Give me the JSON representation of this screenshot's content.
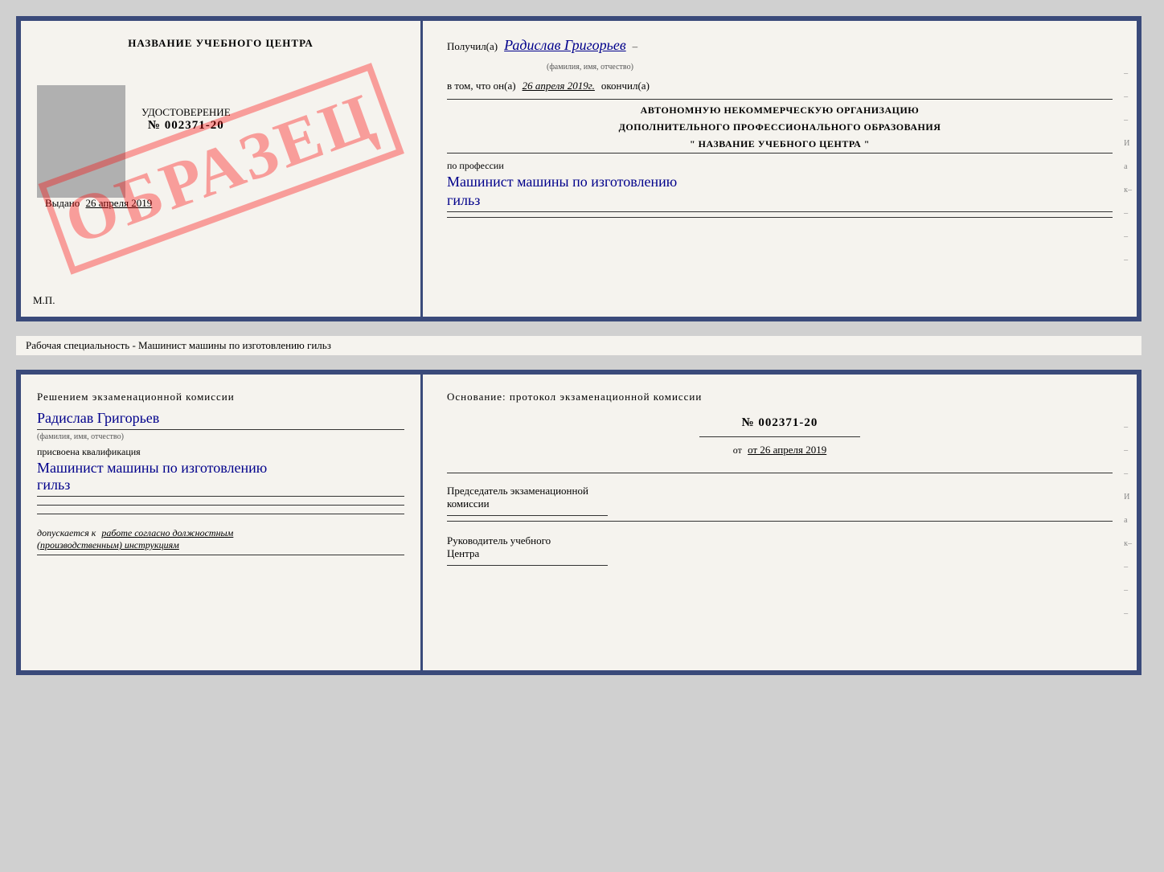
{
  "topCert": {
    "leftTitle": "НАЗВАНИЕ УЧЕБНОГО ЦЕНТРА",
    "photoAlt": "photo",
    "udostoverenie": "УДОСТОВЕРЕНИЕ",
    "number": "№ 002371-20",
    "vydano": "Выдано",
    "vydanoDate": "26 апреля 2019",
    "mp": "М.П.",
    "obrazec": "ОБРАЗЕЦ",
    "poluchil": "Получил(а)",
    "recipientName": "Радислав Григорьев",
    "fioLabel": "(фамилия, имя, отчество)",
    "vtom": "в том, что он(а)",
    "completionDate": "26 апреля 2019г.",
    "okonchil": "окончил(а)",
    "dash1": "–",
    "orgLine1": "АВТОНОМНУЮ НЕКОММЕРЧЕСКУЮ ОРГАНИЗАЦИЮ",
    "orgLine2": "ДОПОЛНИТЕЛЬНОГО ПРОФЕССИОНАЛЬНОГО ОБРАЗОВАНИЯ",
    "orgLine3": "\"   НАЗВАНИЕ УЧЕБНОГО ЦЕНТРА   \"",
    "dash2": "–",
    "poProfessii": "по профессии",
    "professionText": "Машинист машины по изготовлению",
    "professionText2": "гильз"
  },
  "middleLabel": "Рабочая специальность - Машинист машины по изготовлению гильз",
  "bottomCert": {
    "decisionTitle": "Решением  экзаменационной  комиссии",
    "recipientName": "Радислав Григорьев",
    "fioLabel": "(фамилия, имя, отчество)",
    "assignedLabel": "присвоена квалификация",
    "qualification": "Машинист машины по изготовлению",
    "qualification2": "гильз",
    "dopuskaetsya": "допускается к",
    "workText": "работе согласно должностным",
    "workText2": "(производственным) инструкциям",
    "osnovaniyeTitle": "Основание:  протокол  экзаменационной  комиссии",
    "protocolNum": "№  002371-20",
    "otDate": "от 26 апреля 2019",
    "predsedatel": "Председатель экзаменационной",
    "komissii": "комиссии",
    "rukovoditel": "Руководитель учебного",
    "tsentra": "Центра",
    "dash3": "–",
    "dash4": "–",
    "dash5": "–",
    "dashI": "И",
    "dashA": "а",
    "dashK": "к–"
  }
}
